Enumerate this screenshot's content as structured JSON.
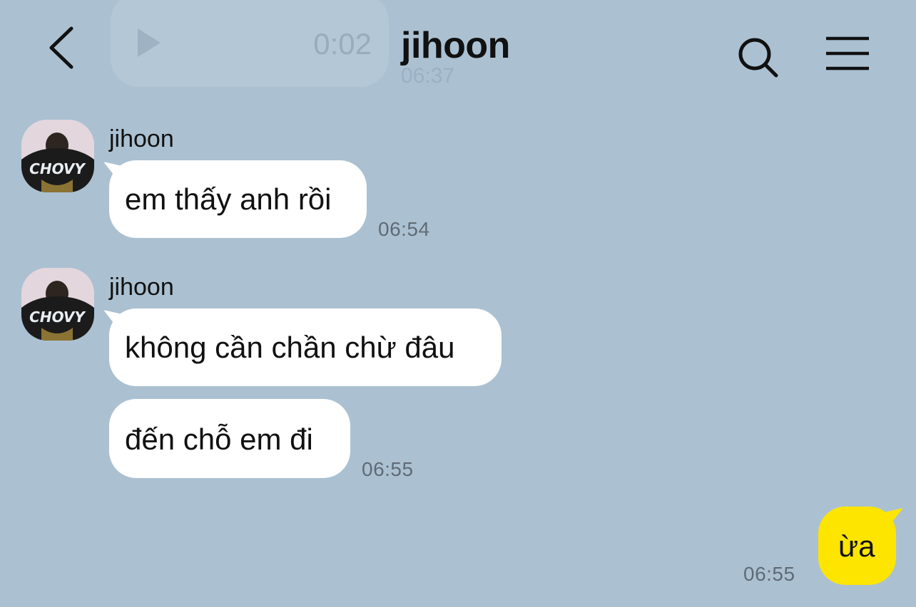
{
  "header": {
    "title": "jihoon"
  },
  "ghost_message": {
    "duration": "0:02",
    "time": "06:37"
  },
  "messages": [
    {
      "sender": "jihoon",
      "text": "em thấy anh rồi",
      "time": "06:54"
    },
    {
      "sender": "jihoon",
      "text": "không cần chần chừ đâu"
    },
    {
      "text": "đến chỗ em đi",
      "time": "06:55"
    },
    {
      "sender": "me",
      "text": "ừa",
      "time": "06:55"
    }
  ],
  "avatar": {
    "shirt_text": "CHOVY"
  },
  "colors": {
    "background": "#abc1d2",
    "incoming_bubble": "#ffffff",
    "outgoing_bubble": "#fee500",
    "timestamp": "#5f6b75"
  }
}
